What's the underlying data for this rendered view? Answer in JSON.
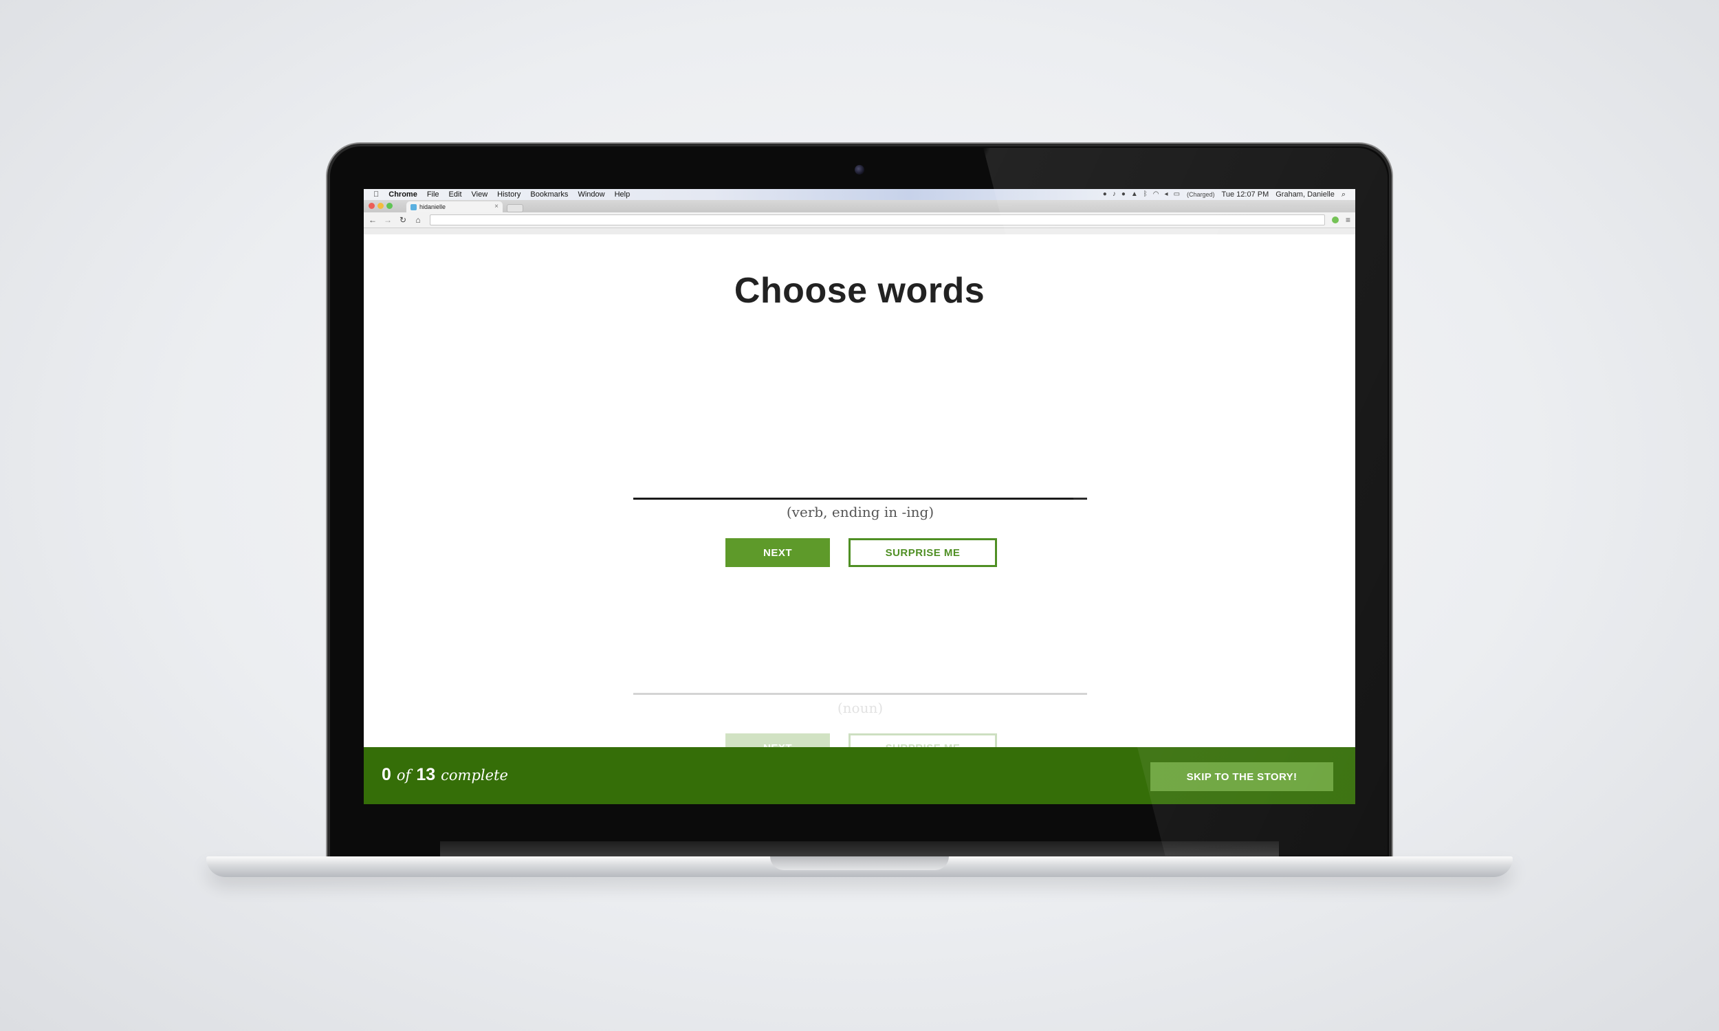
{
  "mac_menubar": {
    "app_name": "Chrome",
    "menus": [
      "File",
      "Edit",
      "View",
      "History",
      "Bookmarks",
      "Window",
      "Help"
    ],
    "battery_status": "(Charged)",
    "clock": "Tue 12:07 PM",
    "user": "Graham, Danielle"
  },
  "browser": {
    "tab_title": "hidanielle",
    "tab_close": "×"
  },
  "page": {
    "title": "Choose words",
    "prompts": [
      {
        "hint": "(verb, ending in -ing)",
        "next_label": "NEXT",
        "surprise_label": "SURPRISE ME"
      },
      {
        "hint": "(noun)",
        "next_label": "NEXT",
        "surprise_label": "SURPRISE ME"
      }
    ]
  },
  "footer": {
    "completed": "0",
    "of_word": "of",
    "total": "13",
    "complete_word": "complete",
    "skip_label": "SKIP TO THE STORY!"
  },
  "colors": {
    "accent_green": "#5e9a2a",
    "footer_green": "#356e08",
    "skip_button_green": "#6aa33a"
  }
}
